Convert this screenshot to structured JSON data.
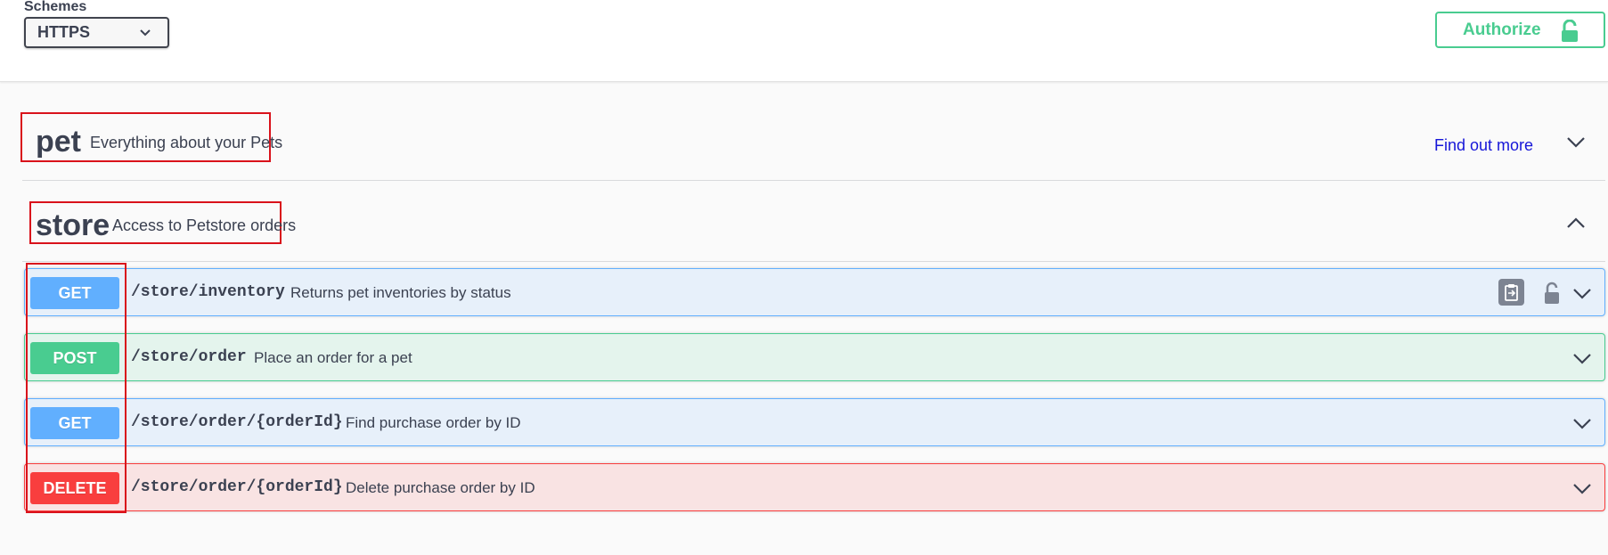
{
  "schemes": {
    "title": "Schemes",
    "selected": "HTTPS",
    "icon": "chevron-down-icon"
  },
  "authorize": {
    "label": "Authorize",
    "icon": "unlocked-icon"
  },
  "tags": [
    {
      "name": "pet",
      "description": "Everything about your Pets",
      "link": "Find out more",
      "expanded": false,
      "icon": "chevron-down-icon"
    },
    {
      "name": "store",
      "description": "Access to Petstore orders",
      "expanded": true,
      "icon": "chevron-up-icon"
    }
  ],
  "operations": [
    {
      "method": "GET",
      "path": "/store/inventory",
      "summary": "Returns pet inventories by status",
      "icons": [
        "copy-icon",
        "unlocked-icon",
        "chevron-down-icon"
      ]
    },
    {
      "method": "POST",
      "path": "/store/order",
      "summary": "Place an order for a pet",
      "icons": [
        "chevron-down-icon"
      ]
    },
    {
      "method": "GET",
      "path": "/store/order/{orderId}",
      "summary": "Find purchase order by ID",
      "icons": [
        "chevron-down-icon"
      ]
    },
    {
      "method": "DELETE",
      "path": "/store/order/{orderId}",
      "summary": "Delete purchase order by ID",
      "icons": [
        "chevron-down-icon"
      ]
    }
  ],
  "colors": {
    "get": "#61affe",
    "post": "#49cc90",
    "delete": "#f93e3e",
    "authorize": "#49cc90",
    "highlight": "#d9121b",
    "link": "#1616d8"
  }
}
